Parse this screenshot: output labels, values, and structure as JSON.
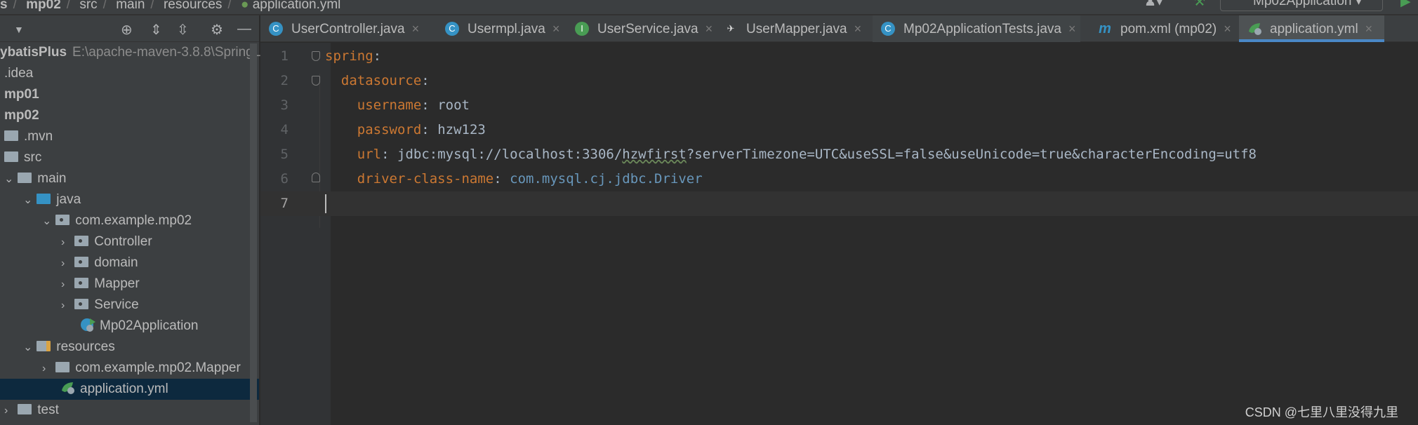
{
  "breadcrumb": [
    "s",
    "mp02",
    "src",
    "main",
    "resources",
    "application.yml"
  ],
  "run_config": "Mp02Application",
  "project_panel": {
    "root": {
      "name": "ybatisPlus",
      "path": "E:\\apache-maven-3.8.8\\SpringL"
    },
    "items": [
      {
        "label": ".idea"
      },
      {
        "label": "mp01"
      },
      {
        "label": "mp02"
      },
      {
        "label": ".mvn"
      },
      {
        "label": "src"
      },
      {
        "label": "main"
      },
      {
        "label": "java"
      },
      {
        "label": "com.example.mp02"
      },
      {
        "label": "Controller"
      },
      {
        "label": "domain"
      },
      {
        "label": "Mapper"
      },
      {
        "label": "Service"
      },
      {
        "label": "Mp02Application"
      },
      {
        "label": "resources"
      },
      {
        "label": "com.example.mp02.Mapper"
      },
      {
        "label": "application.yml"
      },
      {
        "label": "test"
      }
    ],
    "selected": "application.yml"
  },
  "tabs": [
    {
      "label": "UserController.java",
      "icon": "class-icon"
    },
    {
      "label": "Usermpl.java",
      "icon": "class-icon"
    },
    {
      "label": "UserService.java",
      "icon": "interface-icon"
    },
    {
      "label": "UserMapper.java",
      "icon": "mapper-icon"
    },
    {
      "label": "Mp02ApplicationTests.java",
      "icon": "test-class-icon"
    },
    {
      "label": "pom.xml (mp02)",
      "icon": "maven-icon"
    },
    {
      "label": "application.yml",
      "icon": "spring-yml-icon",
      "active": true
    }
  ],
  "editor": {
    "lines": [
      {
        "n": "1",
        "key": "spring",
        "value": ""
      },
      {
        "n": "2",
        "key": "datasource",
        "value": ""
      },
      {
        "n": "3",
        "key": "username",
        "value": "root"
      },
      {
        "n": "4",
        "key": "password",
        "value": "hzw123"
      },
      {
        "n": "5",
        "key": "url",
        "value_pre": "jdbc:mysql://localhost:3306/",
        "value_squig": "hzwfirst",
        "value_post": "?serverTimezone=UTC&useSSL=false&useUnicode=true&characterEncoding=utf8"
      },
      {
        "n": "6",
        "key": "driver-class-name",
        "value": "com.mysql.cj.jdbc.Driver"
      },
      {
        "n": "7"
      }
    ],
    "colon": ":"
  },
  "watermark": "CSDN @七里八里没得九里",
  "colors": {
    "key": "#cc7832",
    "value": "#a9b7c6",
    "class_ref": "#6897bb",
    "selection": "#0d293e",
    "active_tab_underline": "#4a88c7"
  }
}
